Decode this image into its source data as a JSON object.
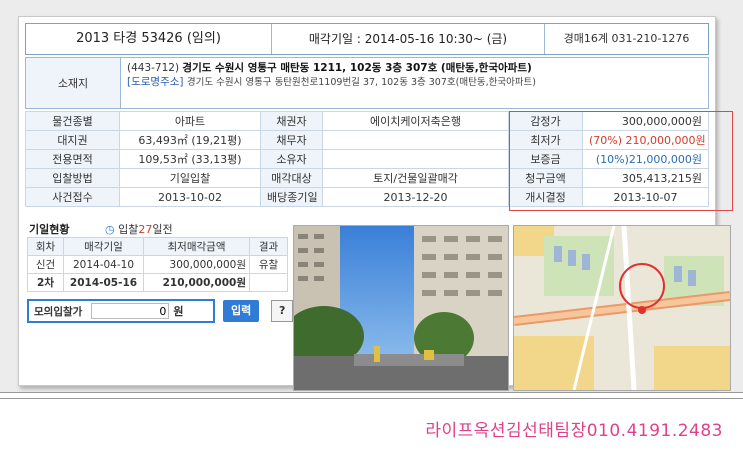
{
  "header": {
    "case_no": "2013 타경 53426 (임의)",
    "sale_date": "매각기일 : 2014-05-16   10:30~ (금)",
    "dept": "경매16계 031-210-1276"
  },
  "address": {
    "label": "소재지",
    "zip": "(443-712)",
    "main": "경기도 수원시 영통구 매탄동 1211, 102동 3층 307호 (매탄동,한국아파트)",
    "road_tag": "[도로명주소]",
    "road": "경기도 수원시 영통구 동탄원천로1109번길 37, 102동 3층 307호(매탄동,한국아파트)"
  },
  "info": {
    "rows": [
      {
        "k1": "물건종별",
        "v1": "아파트",
        "k2": "채권자",
        "v2": "에이치케이저축은행",
        "k3": "감정가",
        "v3": "300,000,000원"
      },
      {
        "k1": "대지권",
        "v1": "63,493㎡ (19,21평)",
        "k2": "채무자",
        "v2": "",
        "k3": "최저가",
        "v3": "(70%) 210,000,000원"
      },
      {
        "k1": "전용면적",
        "v1": "109,53㎡ (33,13평)",
        "k2": "소유자",
        "v2": "",
        "k3": "보증금",
        "v3": "(10%)21,000,000원"
      },
      {
        "k1": "입찰방법",
        "v1": "기일입찰",
        "k2": "매각대상",
        "v2": "토지/건물일괄매각",
        "k3": "청구금액",
        "v3": "305,413,215원"
      },
      {
        "k1": "사건접수",
        "v1": "2013-10-02",
        "k2": "배당종기일",
        "v2": "2013-12-20",
        "k3": "개시결정",
        "v3": "2013-10-07"
      }
    ]
  },
  "history": {
    "title": "기일현황",
    "sub_prefix": "입찰",
    "sub_days": "27",
    "sub_suffix": "일전",
    "headers": [
      "회차",
      "매각기일",
      "최저매각금액",
      "결과"
    ],
    "rows": [
      [
        "신건",
        "2014-04-10",
        "300,000,000원",
        "유찰"
      ],
      [
        "2차",
        "2014-05-16",
        "210,000,000원",
        ""
      ]
    ]
  },
  "calculator": {
    "label": "모의입찰가",
    "value": "0",
    "unit": "원",
    "submit": "입력",
    "help": "?"
  },
  "footer": {
    "contact": "라이프옥션김선태팀장010.4191.2483"
  },
  "colors": {
    "accent_blue": "#2f7bd6",
    "highlight_red": "#e04848",
    "footer_pink": "#e0418c"
  }
}
